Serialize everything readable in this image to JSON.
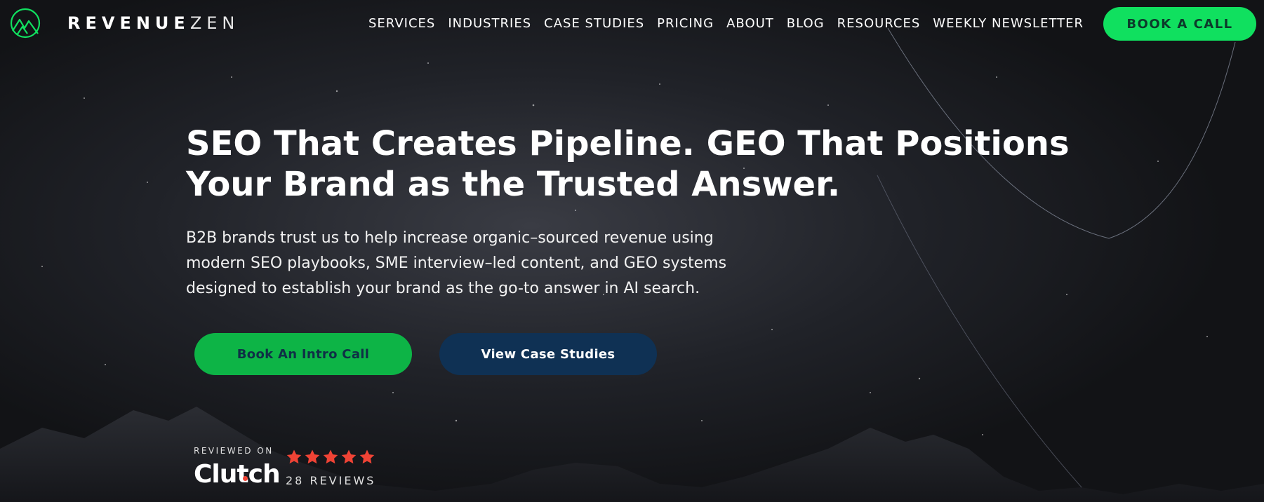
{
  "brand": {
    "name_bold": "REVENUE",
    "name_light": "ZEN",
    "logo_icon": "mountain-circle-logo",
    "accent_color": "#10e05f"
  },
  "nav": {
    "items": [
      {
        "label": "SERVICES"
      },
      {
        "label": "INDUSTRIES"
      },
      {
        "label": "CASE STUDIES"
      },
      {
        "label": "PRICING"
      },
      {
        "label": "ABOUT"
      },
      {
        "label": "BLOG"
      },
      {
        "label": "RESOURCES"
      },
      {
        "label": "WEEKLY NEWSLETTER"
      }
    ],
    "cta_label": "BOOK A CALL"
  },
  "hero": {
    "title_line1": "SEO That Creates Pipeline. GEO That Positions",
    "title_line2": "Your Brand as the Trusted Answer.",
    "sub_line1": "B2B brands trust us to help increase organic–sourced revenue using",
    "sub_line2": "modern SEO playbooks, SME interview–led content, and GEO systems",
    "sub_line3": "designed to establish your brand as the go-to answer in AI search.",
    "primary_button": "Book An Intro Call",
    "secondary_button": "View Case Studies",
    "primary_color": "#0db446",
    "secondary_color": "#0f3154"
  },
  "clutch": {
    "reviewed_on": "REVIEWED ON",
    "logo_word": "Clutch",
    "rating": 5,
    "reviews": "28 REVIEWS",
    "star_color": "#ef4335"
  }
}
